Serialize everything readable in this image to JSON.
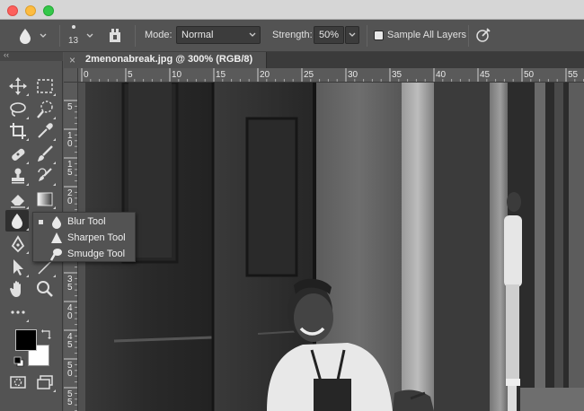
{
  "options_bar": {
    "brush_size": "13",
    "mode_label": "Mode:",
    "mode_value": "Normal",
    "strength_label": "Strength:",
    "strength_value": "50%",
    "sample_all_layers_label": "Sample All Layers",
    "sample_all_layers_checked": false
  },
  "document_tab": {
    "close": "×",
    "title": "2menonabreak.jpg @ 300% (RGB/8)"
  },
  "panel_collapse": "‹‹",
  "ruler_top": [
    "0",
    "5",
    "10",
    "15",
    "20",
    "25",
    "30",
    "35",
    "40",
    "45",
    "50",
    "55"
  ],
  "ruler_left": [
    "5",
    "1\n0",
    "1\n5",
    "2\n0",
    "2\n5",
    "3\n0",
    "3\n5",
    "4\n0",
    "4\n5",
    "5\n0",
    "5\n5"
  ],
  "flyout": {
    "items": [
      {
        "label": "Blur Tool",
        "icon": "blur-drop-icon",
        "selected": true
      },
      {
        "label": "Sharpen Tool",
        "icon": "sharpen-triangle-icon",
        "selected": false
      },
      {
        "label": "Smudge Tool",
        "icon": "smudge-finger-icon",
        "selected": false
      }
    ]
  },
  "tools": [
    "move-icon",
    "marquee-icon",
    "lasso-icon",
    "quick-select-icon",
    "crop-icon",
    "eyedropper-icon",
    "healing-brush-icon",
    "brush-icon",
    "clone-stamp-icon",
    "history-brush-icon",
    "eraser-icon",
    "gradient-icon",
    "blur-icon",
    "pen-icon",
    "path-select-icon",
    "hand-icon",
    "zoom-icon",
    "more-icon",
    "foreground-color",
    "background-color",
    "quick-mask-icon",
    "screen-mode-icon"
  ],
  "colors": {
    "foreground": "#000000",
    "background": "#ffffff",
    "ui_panel": "#535353",
    "ui_dark": "#3b3b3b"
  }
}
